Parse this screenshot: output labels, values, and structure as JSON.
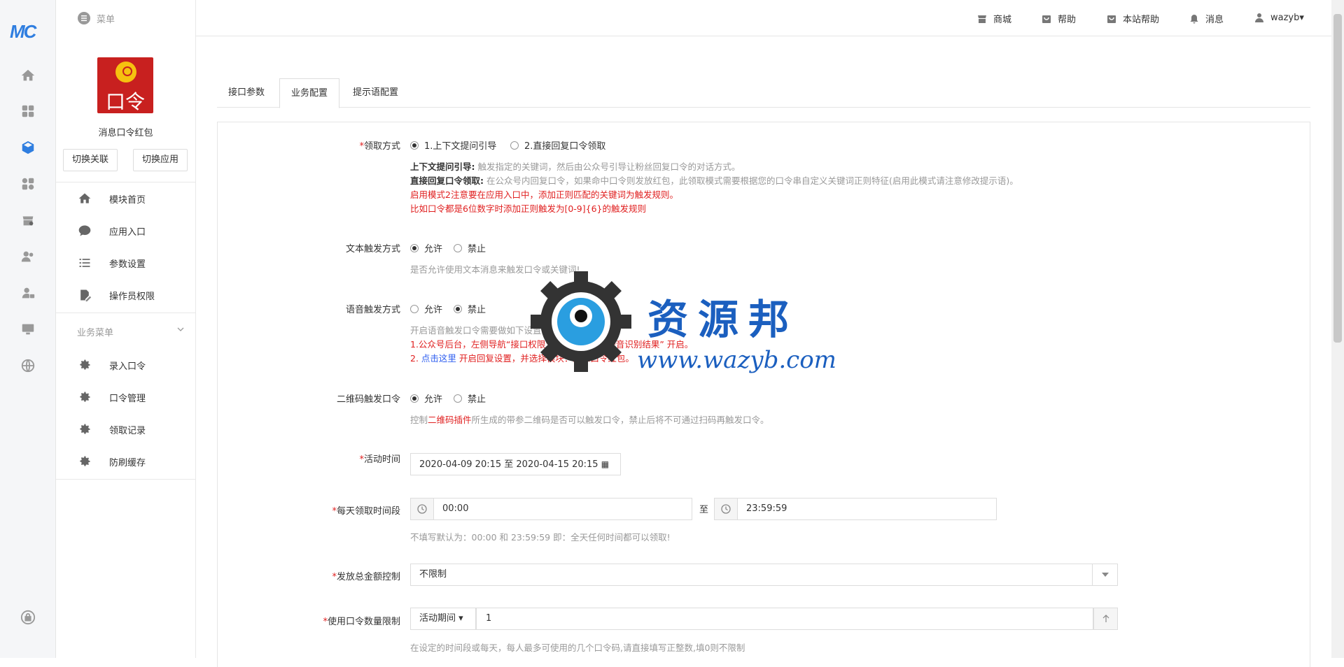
{
  "rail": {
    "logo": "MC",
    "icons": [
      "home-icon",
      "apps-icon",
      "cube-icon",
      "widgets-icon",
      "store-icon",
      "users-icon",
      "user-lock-icon",
      "monitor-icon",
      "globe-icon",
      "lock-icon"
    ]
  },
  "sidebar": {
    "app_name": "消息口令红包",
    "app_icon_text": "口令",
    "switch_link": "切换关联",
    "switch_app": "切换应用",
    "items": [
      {
        "label": "模块首页",
        "icon": "home-icon"
      },
      {
        "label": "应用入口",
        "icon": "chat-icon"
      },
      {
        "label": "参数设置",
        "icon": "list-icon"
      },
      {
        "label": "操作员权限",
        "icon": "edit-doc-icon"
      }
    ],
    "group_title": "业务菜单",
    "group_items": [
      {
        "label": "录入口令",
        "icon": "gear-icon"
      },
      {
        "label": "口令管理",
        "icon": "gear-icon"
      },
      {
        "label": "领取记录",
        "icon": "gear-icon"
      },
      {
        "label": "防刷缓存",
        "icon": "gear-icon"
      }
    ]
  },
  "topbar": {
    "menu_label": "菜单",
    "links": [
      {
        "label": "商城",
        "icon": "store-icon"
      },
      {
        "label": "帮助",
        "icon": "bag-icon"
      },
      {
        "label": "本站帮助",
        "icon": "bag-icon"
      },
      {
        "label": "消息",
        "icon": "bell-icon"
      },
      {
        "label": "wazyb▾",
        "icon": "user-icon"
      }
    ]
  },
  "tabs": [
    "接口参数",
    "业务配置",
    "提示语配置"
  ],
  "form": {
    "claim_mode": {
      "label": "领取方式",
      "options": [
        "1.上下文提问引导",
        "2.直接回复口令领取"
      ],
      "help1_bold": "上下文提问引导:",
      "help1": " 触发指定的关键词，然后由公众号引导让粉丝回复口令的对话方式。",
      "help2_bold": "直接回复口令领取:",
      "help2": " 在公众号内回复口令，如果命中口令则发放红包，此领取模式需要根据您的口令串自定义关键词正则特征(启用此模式请注意修改提示语)。",
      "warn1": "启用模式2注意要在应用入口中，添加正则匹配的关键词为触发规则。",
      "warn2": "比如口令都是6位数字时添加正则触发为[0-9]{6}的触发规则"
    },
    "text_trigger": {
      "label": "文本触发方式",
      "options": [
        "允许",
        "禁止"
      ],
      "help": "是否允许使用文本消息来触发口令或关键词!"
    },
    "voice_trigger": {
      "label": "语音触发方式",
      "options": [
        "允许",
        "禁止"
      ],
      "help": "开启语音触发口令需要做如下设置：",
      "warn1": "1.公众号后台，左侧导航“接口权限”中，找到“接收语音识别结果” 开启。",
      "warn2_pre": "2. ",
      "warn2_link": "点击这里",
      "warn2_post": " 开启回复设置，并选择模块：消息口令红包。"
    },
    "qr_trigger": {
      "label": "二维码触发口令",
      "options": [
        "允许",
        "禁止"
      ],
      "help_pre": "控制",
      "help_link": "二维码插件",
      "help_post": "所生成的带参二维码是否可以触发口令，禁止后将不可通过扫码再触发口令。"
    },
    "activity_time": {
      "label": "活动时间",
      "value": "2020-04-09 20:15 至 2020-04-15 20:15"
    },
    "daily_period": {
      "label": "每天领取时间段",
      "start": "00:00",
      "sep": "至",
      "end": "23:59:59",
      "help": "不填写默认为：00:00 和 23:59:59 即：全天任何时间都可以领取!"
    },
    "amount_control": {
      "label": "发放总金额控制",
      "value": "不限制"
    },
    "code_limit": {
      "label": "使用口令数量限制",
      "period": "活动期间 ▾",
      "value": "1",
      "help": "在设定的时间段或每天，每人最多可使用的几个口令码,请直接填写正整数,填0则不限制"
    }
  },
  "watermark": {
    "title": "资源邦",
    "url": "www.wazyb.com"
  }
}
